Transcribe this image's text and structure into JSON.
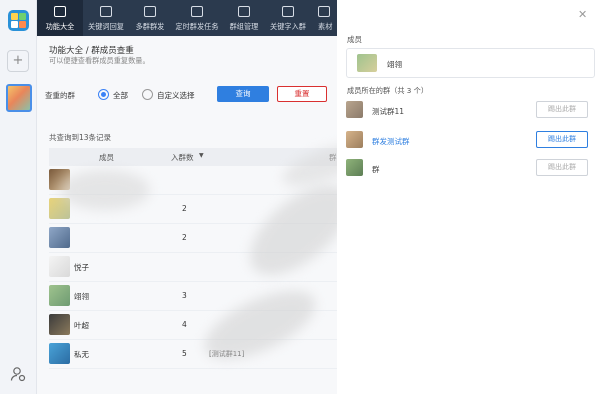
{
  "nav": {
    "tabs": [
      {
        "label": "功能大全",
        "icon": "cube-icon"
      },
      {
        "label": "关键词回复",
        "icon": "text-box-icon"
      },
      {
        "label": "多群群发",
        "icon": "edit-icon"
      },
      {
        "label": "定时群发任务",
        "icon": "timer-icon"
      },
      {
        "label": "群组管理",
        "icon": "layers-icon"
      },
      {
        "label": "关键字入群",
        "icon": "user-add-icon"
      },
      {
        "label": "素材",
        "icon": "folder-icon"
      }
    ]
  },
  "page": {
    "title": "功能大全 / 群成员查重",
    "subtitle": "可以便捷查看群成员重复数量。"
  },
  "filter": {
    "label": "查重的群",
    "option_all": "全部",
    "option_custom": "自定义选择",
    "query_button": "查询",
    "reset_button": "重置"
  },
  "results": {
    "count_text": "共查询到13条记录",
    "columns": {
      "member": "成员",
      "count": "入群数",
      "groups": "群"
    },
    "rows": [
      {
        "name": "",
        "count": "",
        "groups": ""
      },
      {
        "name": "",
        "count": "2",
        "groups": ""
      },
      {
        "name": "",
        "count": "2",
        "groups": ""
      },
      {
        "name": "悦子",
        "count": "",
        "groups": ""
      },
      {
        "name": "翊翎",
        "count": "3",
        "groups": ""
      },
      {
        "name": "叶超",
        "count": "4",
        "groups": ""
      },
      {
        "name": "私无",
        "count": "5",
        "groups": "[测试群11]"
      }
    ]
  },
  "panel": {
    "member_label": "成员",
    "member_name": "翊翎",
    "groups_label": "成员所在的群（共 3 个）",
    "groups": [
      {
        "name": "测试群11",
        "button": "踢出此群",
        "state": "disabled"
      },
      {
        "name": "群发测试群",
        "button": "踢出此群",
        "state": "active"
      },
      {
        "name": "群",
        "button": "踢出此群",
        "state": "disabled"
      }
    ]
  },
  "colors": {
    "nav_bg": "#2b3a4e",
    "accent": "#2f7fe0",
    "danger": "#d93030"
  }
}
